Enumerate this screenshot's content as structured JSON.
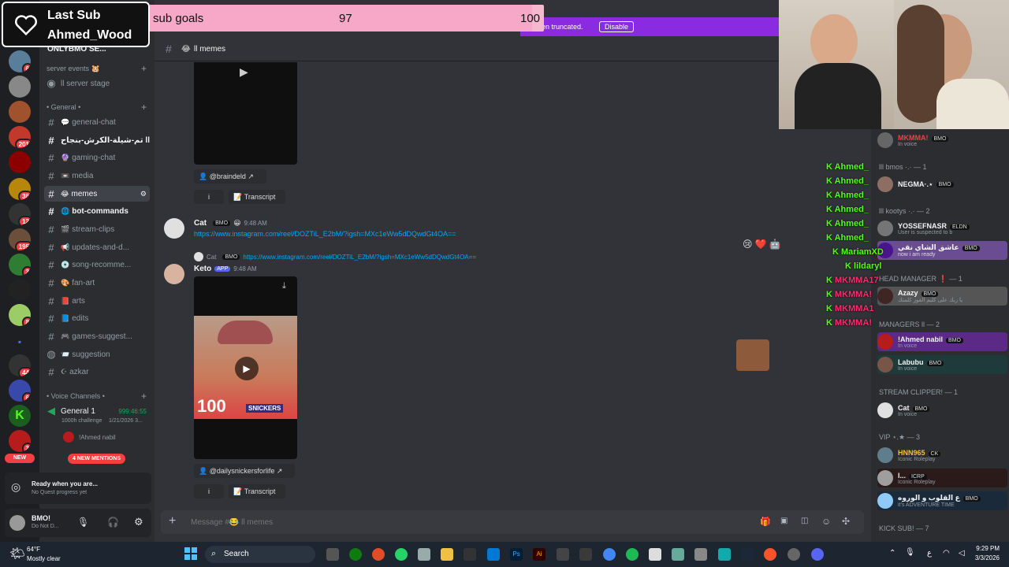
{
  "alert": {
    "title": "Last Sub",
    "name": "Ahmed_Wood"
  },
  "goal": {
    "label": "sub goals",
    "current": "97",
    "target": "100",
    "fraction": 0.97
  },
  "notice": {
    "text": "een truncated.",
    "button": "Disable"
  },
  "header": {
    "channel": "ll memes"
  },
  "server": {
    "name": "ONLYBMO SE..."
  },
  "sidebar": {
    "cat_events": "server events 🐹",
    "stage": "ll server stage",
    "cat_general": "• General •",
    "channels": [
      {
        "label": "general-chat",
        "emoji": "💬"
      },
      {
        "label": "تم-شيلة-الكرش-بنجاح ll",
        "emoji": ""
      },
      {
        "label": "gaming-chat",
        "emoji": "🔮"
      },
      {
        "label": "media",
        "emoji": "📼"
      },
      {
        "label": "memes",
        "emoji": "😂"
      },
      {
        "label": "bot-commands",
        "emoji": "🌐"
      },
      {
        "label": "stream-clips",
        "emoji": "🎬"
      },
      {
        "label": "updates-and-d...",
        "emoji": "📢"
      },
      {
        "label": "song-recomme...",
        "emoji": "💿"
      },
      {
        "label": "fan-art",
        "emoji": "🎨"
      },
      {
        "label": "arts",
        "emoji": "📕"
      },
      {
        "label": "edits",
        "emoji": "📘"
      },
      {
        "label": "games-suggest...",
        "emoji": "🎮"
      },
      {
        "label": "suggestion",
        "emoji": "📨"
      },
      {
        "label": "azkar",
        "emoji": "☪"
      }
    ],
    "cat_voice": "• Voice Channels •",
    "voice": {
      "name": "General 1",
      "timer": "999:46:55",
      "sub": "1000h challenge",
      "date": "1/21/2026 3..."
    },
    "voice_user": "!Ahmed nabil",
    "mentions": "4 NEW MENTIONS",
    "new_badge": "NEW",
    "quest_title": "Ready when you are...",
    "quest_sub": "No Quest progress yet",
    "user_name": "BMO!",
    "user_status": "Do Not D..."
  },
  "rail_badges": [
    "6",
    "201",
    "36",
    "12",
    "195",
    "3",
    "8",
    "44",
    "6",
    "3"
  ],
  "messages": {
    "embed1_handle": "@braindeld",
    "transcript": "Transcript",
    "info": "i",
    "cat_name": "Cat",
    "cat_tag": "BMO",
    "cat_time": "9:48 AM",
    "cat_link": "https://www.instagram.com/reel/DOZTiL_E2bM/?igsh=MXc1eWw5dDQwdGt4OA==",
    "reply_name": "Cat",
    "reply_tag": "BMO",
    "reply_link": "https://www.instagram.com/reel/DOZTiL_E2bM/?igsh=MXc1eWw5dDQwdGt4OA==",
    "keto_name": "Keto",
    "keto_tag": "APP",
    "keto_time": "9:48 AM",
    "video_text": "100",
    "video_brand": "SNICKERS",
    "embed2_handle": "@dailysnickersforlife"
  },
  "composer": {
    "placeholder": "Message #😂 ll memes"
  },
  "members": {
    "top": {
      "name": "MKMMA!",
      "tag": "BMO",
      "sub": "In voice"
    },
    "cat1": "lll bmos ·.· — 1",
    "m1": {
      "name": "NEGMA·.⋆",
      "tag": "BMO"
    },
    "cat2": "lll kootys ·.· — 2",
    "m2": {
      "name": "YOSSEFNASR",
      "tag": "ELDN",
      "sub": "User is suspected to b"
    },
    "m3": {
      "name": "عاشق الشاي نقي",
      "tag": "BMO",
      "sub": "now i am ready"
    },
    "cat3": "HEAD MANAGER ❗ — 1",
    "m4": {
      "name": "Azazy",
      "tag": "BMO",
      "sub": "يا ربك على كليم الفوز كلمتك"
    },
    "cat4": "MANAGERS ll — 2",
    "m5": {
      "name": "!Ahmed nabil",
      "tag": "BMO",
      "sub": "In voice"
    },
    "m6": {
      "name": "Labubu",
      "tag": "BMO",
      "sub": "In voice"
    },
    "cat5": "STREAM CLIPPER! — 1",
    "m7": {
      "name": "Cat",
      "tag": "BMO",
      "sub": "In voice"
    },
    "cat6": "VIP ⋆.★ — 3",
    "m8": {
      "name": "HNN965",
      "tag": "CK",
      "sub": "Iconic Roleplay"
    },
    "m9": {
      "name": "l...",
      "tag": "ICRP",
      "sub": "Iconic Roleplay"
    },
    "m10": {
      "name": "ع القلوب و الوروه",
      "tag": "BMO",
      "sub": "it's ADVENTURE TIME"
    },
    "cat7": "KICK SUB! — 7"
  },
  "twitch_chat": [
    {
      "name": "Ahmed_",
      "color": "#53fc18"
    },
    {
      "name": "Ahmed_",
      "color": "#53fc18"
    },
    {
      "name": "Ahmed_",
      "color": "#53fc18"
    },
    {
      "name": "Ahmed_",
      "color": "#53fc18"
    },
    {
      "name": "Ahmed_",
      "color": "#53fc18"
    },
    {
      "name": "Ahmed_",
      "color": "#53fc18"
    },
    {
      "name": "MariamXD",
      "color": "#53fc18"
    },
    {
      "name": "lildaryl",
      "color": "#53fc18"
    },
    {
      "name": "MKMMA17",
      "color": "#ff2a6d"
    },
    {
      "name": "MKMMA!",
      "color": "#ff2a6d"
    },
    {
      "name": "MKMMA1",
      "color": "#ff2a6d"
    },
    {
      "name": "MKMMA!",
      "color": "#ff2a6d"
    }
  ],
  "taskbar": {
    "weather_temp": "64°F",
    "weather_desc": "Mostly clear",
    "search": "Search",
    "time": "9:29 PM",
    "date": "3/3/2026",
    "lang": "ع"
  }
}
